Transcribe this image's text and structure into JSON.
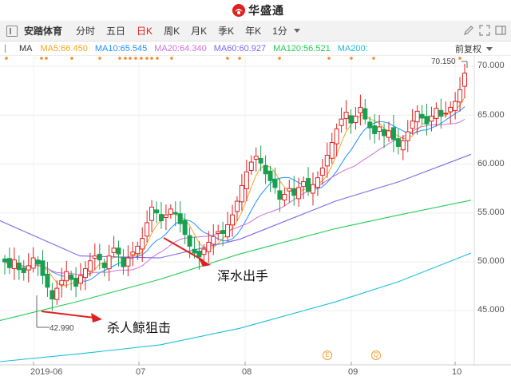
{
  "brand": {
    "name": "华盛通"
  },
  "toolbar": {
    "stock_name": "安踏体育",
    "periods": [
      "分时",
      "五日",
      "日K",
      "周K",
      "月K",
      "季K",
      "年K"
    ],
    "active_period": "日K",
    "interval": "1分"
  },
  "ma_bar": {
    "label": "MA",
    "items": [
      {
        "text": "MA5:66.450",
        "color": "#f5a623"
      },
      {
        "text": "MA10:65.545",
        "color": "#1e90ff"
      },
      {
        "text": "MA20:64.340",
        "color": "#d070d8"
      },
      {
        "text": "MA60:60.927",
        "color": "#7b68ee"
      },
      {
        "text": "MA120:56.521",
        "color": "#22cc55"
      },
      {
        "text": "MA200:",
        "color": "#19c0d8"
      }
    ],
    "adjust_label": "前复权"
  },
  "y_axis": {
    "ticks": [
      "70.000",
      "65.000",
      "60.000",
      "55.000",
      "50.000",
      "45.000"
    ]
  },
  "x_axis": {
    "ticks": [
      "2019-06",
      "07",
      "08",
      "09",
      "10"
    ]
  },
  "price_tags": {
    "high": "70.150",
    "low": "42.990"
  },
  "event_markers": [
    "E",
    "Q"
  ],
  "annotations": {
    "buy_note": "杀人鲸狙击",
    "sell_note": "浑水出手"
  },
  "colors": {
    "up": "#e02020",
    "down": "#18a050",
    "arrow": "#e02020"
  }
}
